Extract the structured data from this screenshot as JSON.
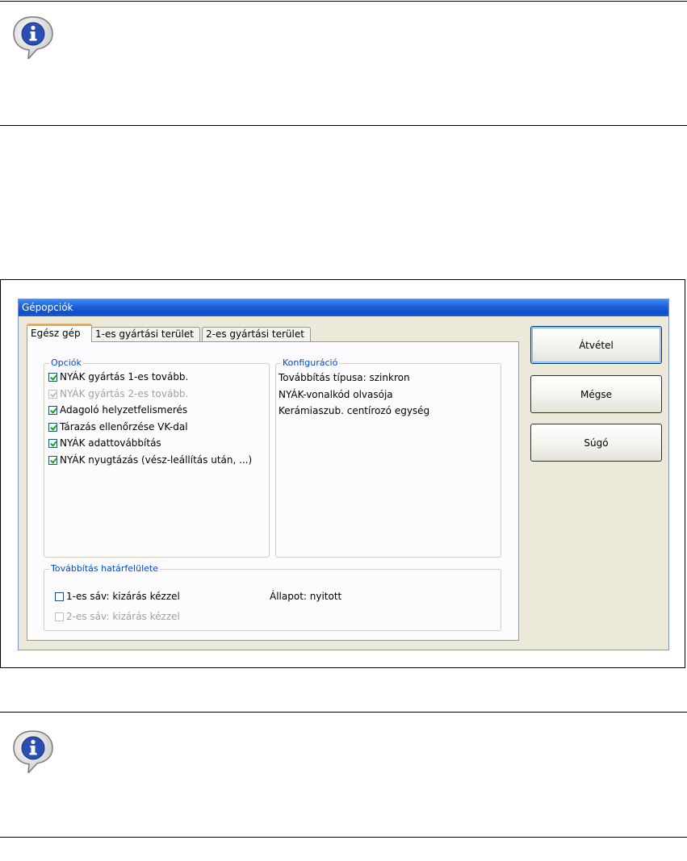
{
  "window": {
    "title": "Gépopciók"
  },
  "tabs": [
    {
      "label": "Egész gép",
      "active": true
    },
    {
      "label": "1-es gyártási terület",
      "active": false
    },
    {
      "label": "2-es gyártási terület",
      "active": false
    }
  ],
  "options_group": {
    "legend": "Opciók",
    "items": [
      {
        "label": "NYÁK gyártás 1-es tovább.",
        "checked": true,
        "disabled": false
      },
      {
        "label": "NYÁK gyártás 2-es tovább.",
        "checked": true,
        "disabled": true
      },
      {
        "label": "Adagoló helyzetfelismerés",
        "checked": true,
        "disabled": false
      },
      {
        "label": "Tárazás ellenőrzése VK-dal",
        "checked": true,
        "disabled": false
      },
      {
        "label": "NYÁK adattovábbítás",
        "checked": true,
        "disabled": false
      },
      {
        "label": "NYÁK nyugtázás (vész-leállítás után, ...)",
        "checked": true,
        "disabled": false
      }
    ]
  },
  "config_group": {
    "legend": "Konfiguráció",
    "lines": [
      "Továbbítás típusa: szinkron",
      "NYÁK-vonalkód olvasója",
      "Kerámiaszub. centírozó egység"
    ]
  },
  "interface_group": {
    "legend": "Továbbítás határfelülete",
    "lane1": {
      "label": "1-es sáv: kizárás kézzel",
      "checked": false,
      "disabled": false
    },
    "lane2": {
      "label": "2-es sáv: kizárás kézzel",
      "checked": false,
      "disabled": true
    },
    "status": "Állapot: nyitott"
  },
  "buttons": {
    "accept": "Átvétel",
    "cancel": "Mégse",
    "help": "Súgó"
  },
  "colors": {
    "titlebar": "#0d4fcc",
    "tab_highlight": "#f5a742",
    "legend_text": "#0046d5",
    "check_mark": "#21a121"
  }
}
